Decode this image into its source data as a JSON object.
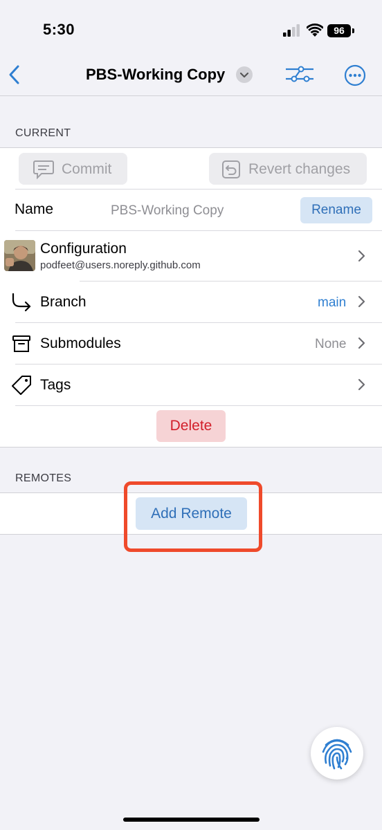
{
  "status_bar": {
    "time": "5:30",
    "battery": "96"
  },
  "nav": {
    "title": "PBS-Working Copy"
  },
  "current": {
    "section_label": "CURRENT",
    "commit_label": "Commit",
    "revert_label": "Revert changes",
    "name_label": "Name",
    "name_value": "PBS-Working Copy",
    "rename_label": "Rename",
    "configuration_label": "Configuration",
    "configuration_email": "podfeet@users.noreply.github.com",
    "branch_label": "Branch",
    "branch_value": "main",
    "submodules_label": "Submodules",
    "submodules_value": "None",
    "tags_label": "Tags",
    "delete_label": "Delete"
  },
  "remotes": {
    "section_label": "REMOTES",
    "add_remote_label": "Add Remote"
  },
  "colors": {
    "accent": "#2f7fd1",
    "danger": "#d21f2a",
    "highlight": "#ef4a2b"
  }
}
